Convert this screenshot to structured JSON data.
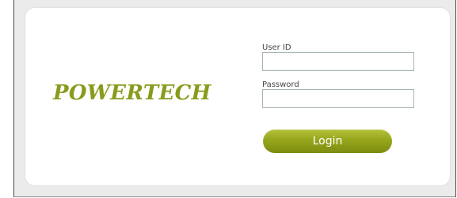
{
  "brand": {
    "logo_text": "POWERTECH",
    "color": "#8a9a1c"
  },
  "login_form": {
    "user_id_label": "User ID",
    "user_id_value": "",
    "password_label": "Password",
    "password_value": "",
    "login_button_label": "Login",
    "button_color": "#96a61c"
  }
}
